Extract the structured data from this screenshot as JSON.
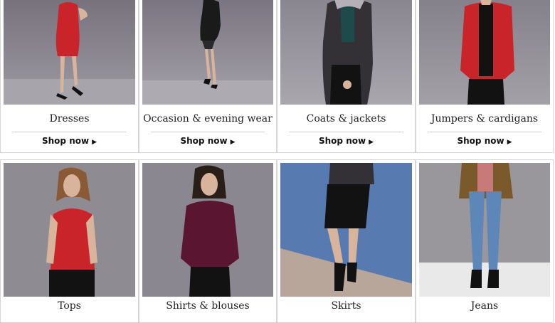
{
  "tiles": [
    {
      "label": "Dresses",
      "shop": "Shop now"
    },
    {
      "label": "Occasion & evening wear",
      "shop": "Shop now"
    },
    {
      "label": "Coats & jackets",
      "shop": "Shop now"
    },
    {
      "label": "Jumpers & cardigans",
      "shop": "Shop now"
    },
    {
      "label": "Tops"
    },
    {
      "label": "Shirts & blouses"
    },
    {
      "label": "Skirts"
    },
    {
      "label": "Jeans"
    }
  ],
  "chevron_icon": "chevron-right-icon",
  "colors": {
    "photo_bg": "#8c8890",
    "border": "#d6d6d6",
    "text": "#222222",
    "dress_red": "#c8242a",
    "blouse_plum": "#5a1630",
    "wall_blue": "#4a6fa8"
  }
}
